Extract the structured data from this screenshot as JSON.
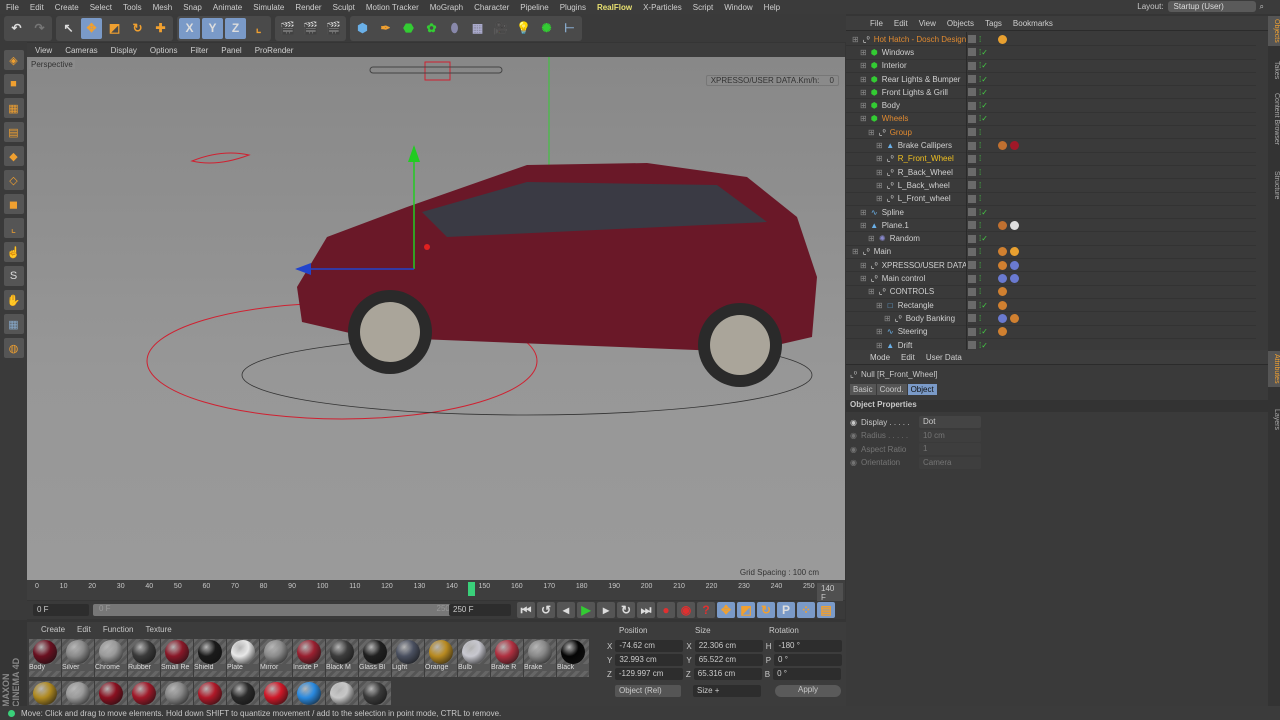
{
  "menubar": {
    "items": [
      "File",
      "Edit",
      "Create",
      "Select",
      "Tools",
      "Mesh",
      "Snap",
      "Animate",
      "Simulate",
      "Render",
      "Sculpt",
      "Motion Tracker",
      "MoGraph",
      "Character",
      "Pipeline",
      "Plugins",
      "RealFlow",
      "X-Particles",
      "Script",
      "Window",
      "Help"
    ],
    "highlight": "RealFlow",
    "layout_label": "Layout:",
    "layout_value": "Startup (User)"
  },
  "toolbar": {
    "axes": [
      "X",
      "Y",
      "Z"
    ]
  },
  "viewport": {
    "menu": [
      "View",
      "Cameras",
      "Display",
      "Options",
      "Filter",
      "Panel",
      "ProRender"
    ],
    "label": "Perspective",
    "xpresso_readout": "XPRESSO/USER DATA.Km/h:",
    "xpresso_value": "0",
    "grid_spacing": "Grid Spacing : 100 cm"
  },
  "timeline": {
    "ticks": [
      "0",
      "10",
      "20",
      "30",
      "40",
      "50",
      "60",
      "70",
      "80",
      "90",
      "100",
      "110",
      "120",
      "130",
      "140",
      "150",
      "160",
      "170",
      "180",
      "190",
      "200",
      "210",
      "220",
      "230",
      "240",
      "250"
    ],
    "current_frame": "140 F",
    "start": "0 F",
    "range_start": "0 F",
    "range_end": "250 F",
    "end": "250 F",
    "current_value": 140,
    "total": 250
  },
  "materials": {
    "menu": [
      "Create",
      "Edit",
      "Function",
      "Texture"
    ],
    "row1": [
      {
        "name": "Body",
        "color": "#6a1020"
      },
      {
        "name": "Silver",
        "color": "#8a8a8a"
      },
      {
        "name": "Chrome",
        "color": "#9a9a9a"
      },
      {
        "name": "Rubber",
        "color": "#3a3a3a"
      },
      {
        "name": "Small Re",
        "color": "#8a1828"
      },
      {
        "name": "Shield",
        "color": "#1a1a1a"
      },
      {
        "name": "Plate",
        "color": "#e8e8e8"
      },
      {
        "name": "Mirror",
        "color": "#8c8c8c"
      },
      {
        "name": "Inside P",
        "color": "#9a2030"
      },
      {
        "name": "Black M",
        "color": "#3c3c3c"
      },
      {
        "name": "Glass Bl",
        "color": "#202020"
      },
      {
        "name": "Light",
        "color": "#4a5060"
      },
      {
        "name": "Orange",
        "color": "#b88a20"
      },
      {
        "name": "Bulb",
        "color": "#c8c8d0"
      },
      {
        "name": "Brake R",
        "color": "#b03040"
      },
      {
        "name": "Brake",
        "color": "#888"
      },
      {
        "name": "Black",
        "color": "#050505"
      }
    ],
    "row2": [
      "#b08a20",
      "#9a9a9a",
      "#8a1020",
      "#a01828",
      "#888",
      "#b01828",
      "#2a2a2a",
      "#d01828",
      "#2a8ae0",
      "#c8c8c8",
      "#3a3a3a"
    ],
    "brand": "MAXON CINEMA 4D"
  },
  "coords": {
    "headers": [
      "Position",
      "Size",
      "Rotation"
    ],
    "rows": [
      {
        "pl": "X",
        "pv": "-74.62 cm",
        "sl": "X",
        "sv": "22.306 cm",
        "rl": "H",
        "rv": "-180 °"
      },
      {
        "pl": "Y",
        "pv": "32.993 cm",
        "sl": "Y",
        "sv": "65.522 cm",
        "rl": "P",
        "rv": "0 °"
      },
      {
        "pl": "Z",
        "pv": "-129.997 cm",
        "sl": "Z",
        "sv": "65.316 cm",
        "rl": "B",
        "rv": "0 °"
      }
    ],
    "mode": "Object (Rel)",
    "size_mode": "Size +",
    "apply": "Apply"
  },
  "status": "Move: Click and drag to move elements. Hold down SHIFT to quantize movement / add to the selection in point mode, CTRL to remove.",
  "objects": {
    "menu": [
      "File",
      "Edit",
      "View",
      "Objects",
      "Tags",
      "Bookmarks"
    ],
    "rows": [
      {
        "name": "Hot Hatch - Dosch Design",
        "icon": "null-icon",
        "color": "#e08a30",
        "level": 0,
        "check": false,
        "tags": [
          "#e8a030"
        ]
      },
      {
        "name": "Windows",
        "icon": "polygon-icon",
        "color": "#d0d0d0",
        "level": 1,
        "check": true,
        "tags": []
      },
      {
        "name": "Interior",
        "icon": "polygon-icon",
        "color": "#d0d0d0",
        "level": 1,
        "check": true,
        "tags": []
      },
      {
        "name": "Rear Lights & Bumper",
        "icon": "polygon-icon",
        "color": "#d0d0d0",
        "level": 1,
        "check": true,
        "tags": []
      },
      {
        "name": "Front Lights & Grill",
        "icon": "polygon-icon",
        "color": "#d0d0d0",
        "level": 1,
        "check": true,
        "tags": []
      },
      {
        "name": "Body",
        "icon": "polygon-icon",
        "color": "#d0d0d0",
        "level": 1,
        "check": true,
        "tags": []
      },
      {
        "name": "Wheels",
        "icon": "polygon-icon",
        "color": "#e08a30",
        "level": 1,
        "check": true,
        "tags": []
      },
      {
        "name": "Group",
        "icon": "null-icon",
        "color": "#e08a30",
        "level": 2,
        "check": false,
        "tags": []
      },
      {
        "name": "Brake Callipers",
        "icon": "mesh-icon",
        "color": "#d0d0d0",
        "level": 3,
        "check": false,
        "tags": [
          "#c07030",
          "#a01828"
        ]
      },
      {
        "name": "R_Front_Wheel",
        "icon": "null-icon",
        "color": "#f0c020",
        "level": 3,
        "check": false,
        "tags": []
      },
      {
        "name": "R_Back_Wheel",
        "icon": "null-icon",
        "color": "#d0d0d0",
        "level": 3,
        "check": false,
        "tags": []
      },
      {
        "name": "L_Back_wheel",
        "icon": "null-icon",
        "color": "#d0d0d0",
        "level": 3,
        "check": false,
        "tags": []
      },
      {
        "name": "L_Front_wheel",
        "icon": "null-icon",
        "color": "#d0d0d0",
        "level": 3,
        "check": false,
        "tags": []
      },
      {
        "name": "Spline",
        "icon": "spline-icon",
        "color": "#d0d0d0",
        "level": 1,
        "check": true,
        "tags": []
      },
      {
        "name": "Plane.1",
        "icon": "mesh-icon",
        "color": "#d0d0d0",
        "level": 1,
        "check": false,
        "tags": [
          "#c07030",
          "#ddd"
        ]
      },
      {
        "name": "Random",
        "icon": "effector-icon",
        "color": "#d0d0d0",
        "level": 2,
        "check": true,
        "tags": []
      },
      {
        "name": "Main",
        "icon": "null-icon",
        "color": "#d0d0d0",
        "level": 0,
        "check": false,
        "tags": [
          "#d08030",
          "#e8a030"
        ]
      },
      {
        "name": "XPRESSO/USER DATA",
        "icon": "null-icon",
        "color": "#d0d0d0",
        "level": 1,
        "check": false,
        "tags": [
          "#d08030",
          "#6a7ad0"
        ]
      },
      {
        "name": "Main control",
        "icon": "null-icon",
        "color": "#d0d0d0",
        "level": 1,
        "check": false,
        "tags": [
          "#6a7ad0",
          "#6a7ad0"
        ]
      },
      {
        "name": "CONTROLS",
        "icon": "null-icon",
        "color": "#d0d0d0",
        "level": 2,
        "check": false,
        "tags": [
          "#d08030"
        ]
      },
      {
        "name": "Rectangle",
        "icon": "rectangle-icon",
        "color": "#d0d0d0",
        "level": 3,
        "check": true,
        "tags": [
          "#d08030"
        ]
      },
      {
        "name": "Body Banking",
        "icon": "null-icon",
        "color": "#d0d0d0",
        "level": 4,
        "check": false,
        "tags": [
          "#6a7ad0",
          "#d08030"
        ]
      },
      {
        "name": "Steering",
        "icon": "spline-icon",
        "color": "#d0d0d0",
        "level": 3,
        "check": true,
        "tags": [
          "#d08030"
        ]
      },
      {
        "name": "Drift",
        "icon": "mesh-icon",
        "color": "#d0d0d0",
        "level": 3,
        "check": true,
        "tags": []
      }
    ]
  },
  "attributes": {
    "menu": [
      "Mode",
      "Edit",
      "User Data"
    ],
    "object_title": "Null [R_Front_Wheel]",
    "tabs": [
      "Basic",
      "Coord.",
      "Object"
    ],
    "active_tab": "Object",
    "section": "Object Properties",
    "props": [
      {
        "label": "Display . . . . .",
        "value": "Dot",
        "enabled": true
      },
      {
        "label": "Radius . . . . .",
        "value": "10 cm",
        "enabled": false
      },
      {
        "label": "Aspect Ratio",
        "value": "1",
        "enabled": false
      },
      {
        "label": "Orientation",
        "value": "Camera",
        "enabled": false
      }
    ]
  },
  "right_tabs": [
    "Objects",
    "Takes",
    "Content Browser",
    "Structure",
    "Attributes",
    "Layers"
  ]
}
